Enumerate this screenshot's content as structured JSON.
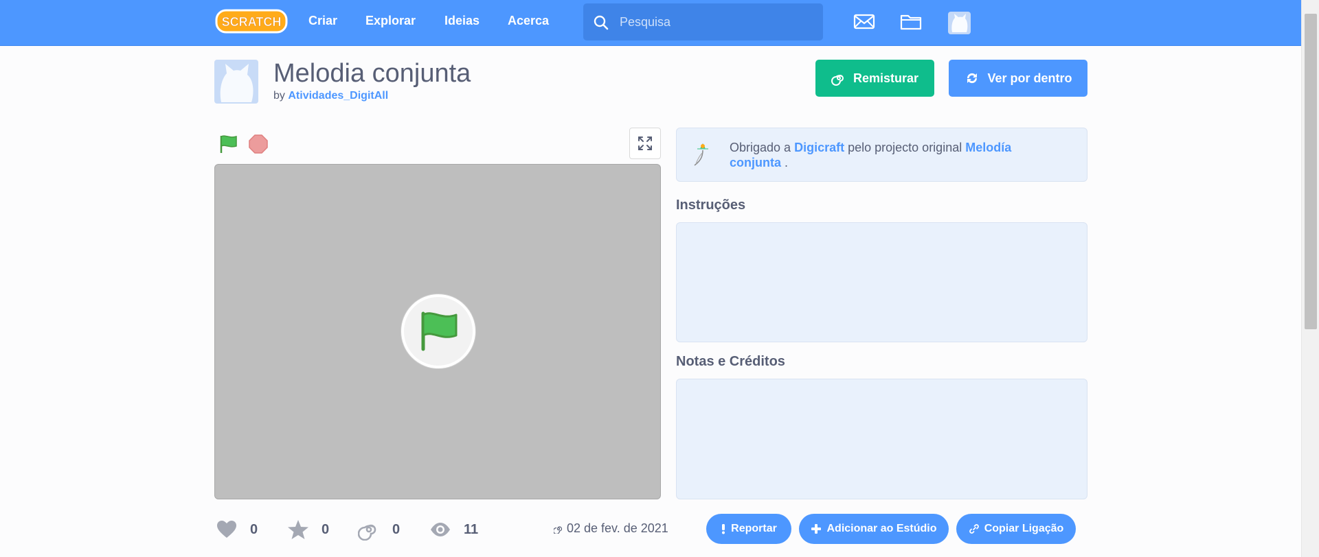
{
  "nav": {
    "logo_text": "SCRATCH",
    "links": [
      "Criar",
      "Explorar",
      "Ideias",
      "Acerca"
    ],
    "search_placeholder": "Pesquisa",
    "icons": [
      "messages-icon",
      "my-stuff-folder-icon",
      "user-avatar"
    ]
  },
  "project": {
    "title": "Melodia conjunta",
    "by_label": "by",
    "author": "Atividades_DigitAll",
    "remix_label": "Remisturar",
    "see_inside_label": "Ver por dentro"
  },
  "credit": {
    "prefix": "Obrigado a",
    "original_author": "Digicraft",
    "middle": "pelo projecto original",
    "original_title": "Melodía conjunta",
    "suffix": "."
  },
  "sections": {
    "instructions_title": "Instruções",
    "instructions_text": "",
    "notes_title": "Notas e Créditos",
    "notes_text": ""
  },
  "stats": {
    "loves": "0",
    "favorites": "0",
    "remixes": "0",
    "views": "11",
    "date": "02 de fev. de 2021"
  },
  "actions": {
    "report": "Reportar",
    "add_to_studio": "Adicionar ao Estúdio",
    "copy_link": "Copiar Ligação"
  },
  "colors": {
    "brand_blue": "#4d97ff",
    "remix_green": "#0fbd8c",
    "stage_gray": "#bebebe",
    "panel_bg": "#e9f1fc"
  }
}
